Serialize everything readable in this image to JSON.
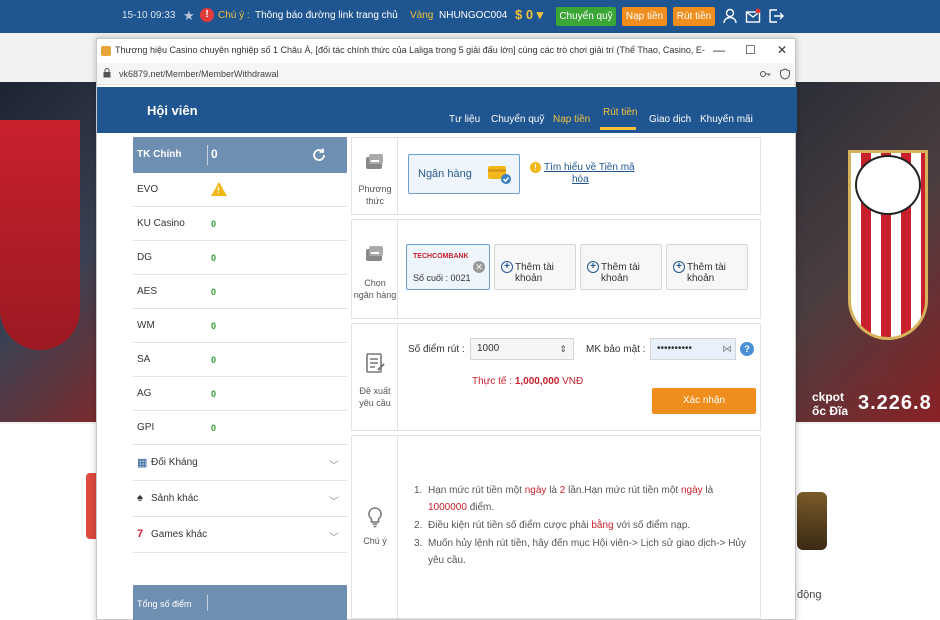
{
  "topbar": {
    "time": "15-10 09:33",
    "notice_label": "Chú ý :",
    "notice_text": "Thông báo đường link trang chủ",
    "vang_label": "Vàng",
    "username": "NHUNGOC004",
    "balance": "$ 0 ▾",
    "transfer_label": "Chuyển quỹ",
    "deposit_label": "Nạp tiền",
    "withdraw_label": "Rút tiền"
  },
  "background": {
    "jackpot_line1": "ckpot",
    "jackpot_line2": "ốc Đĩa",
    "jackpot_value": "3.226.8",
    "right_caption": "động"
  },
  "browser": {
    "title": "Thương hiệu Casino chuyên nghiệp số 1 Châu Á, [đối tác chính thức của Laliga trong 5 giải đấu lớn] cùng các trò chơi giải trí (Thể Thao, Casino, E-Sports,...",
    "url": "vk6879.net/Member/MemberWithdrawal",
    "minimize": "—",
    "maximize": "☐",
    "close": "✕"
  },
  "member": {
    "title": "Hội viên",
    "tabs": [
      {
        "label": "Tư liệu"
      },
      {
        "label": "Chuyển quỹ"
      },
      {
        "label": "Nạp tiền"
      },
      {
        "label": "Rút tiền"
      },
      {
        "label": "Giao dịch"
      },
      {
        "label": "Khuyến mãi"
      }
    ]
  },
  "sidebar": {
    "main_account": {
      "label": "TK Chính",
      "value": "0"
    },
    "wallets": [
      {
        "name": "EVO",
        "value": ""
      },
      {
        "name": "KU Casino",
        "value": "0"
      },
      {
        "name": "DG",
        "value": "0"
      },
      {
        "name": "AES",
        "value": "0"
      },
      {
        "name": "WM",
        "value": "0"
      },
      {
        "name": "SA",
        "value": "0"
      },
      {
        "name": "AG",
        "value": "0"
      },
      {
        "name": "GPI",
        "value": "0"
      }
    ],
    "groups": [
      {
        "name": "Đối Kháng",
        "icon": "grid-icon"
      },
      {
        "name": "Sảnh khác",
        "icon": "spade-icon"
      },
      {
        "name": "Games khác",
        "icon": "seven-icon"
      }
    ],
    "total_label": "Tổng số điểm"
  },
  "method": {
    "label_line1": "Phương",
    "label_line2": "thức",
    "bank_label": "Ngân hàng",
    "learn_line1": "Tìm hiểu về Tiền mã",
    "learn_line2": "hóa"
  },
  "bank_select": {
    "label_line1": "Chọn",
    "label_line2": "ngân hàng",
    "card": {
      "bank": "TECHCOMBANK",
      "last_digits": "Số cuối : 0021"
    },
    "add_label": "Thêm tài khoản"
  },
  "request": {
    "label_line1": "Đề xuất",
    "label_line2": "yêu cầu",
    "amount_label": "Số điểm rút :",
    "amount_value": "1000",
    "password_label": "MK bảo mật :",
    "password_value": "••••••••••",
    "actual_label": "Thực tế :",
    "actual_value": "1,000,000",
    "actual_unit": "VNĐ",
    "confirm_label": "Xác nhận"
  },
  "notes": {
    "label": "Chú ý",
    "items": [
      {
        "num": "1.",
        "a": "Hạn mức rút tiền một ",
        "b": "ngày",
        "c": " là ",
        "d": "2",
        "e": " lần.Hạn mức rút tiền một ",
        "f": "ngày",
        "g": " là ",
        "h": "1000000",
        "i": " điểm."
      },
      {
        "num": "2.",
        "a": "Điều kiện rút tiền số điểm cược phải ",
        "b": "bằng",
        "c": " với số điểm nạp."
      },
      {
        "num": "3.",
        "a": "Muốn hủy lệnh rút tiền, hãy đến mục Hội viên-> Lịch sử giao dịch-> Hủy yêu cầu."
      }
    ]
  }
}
